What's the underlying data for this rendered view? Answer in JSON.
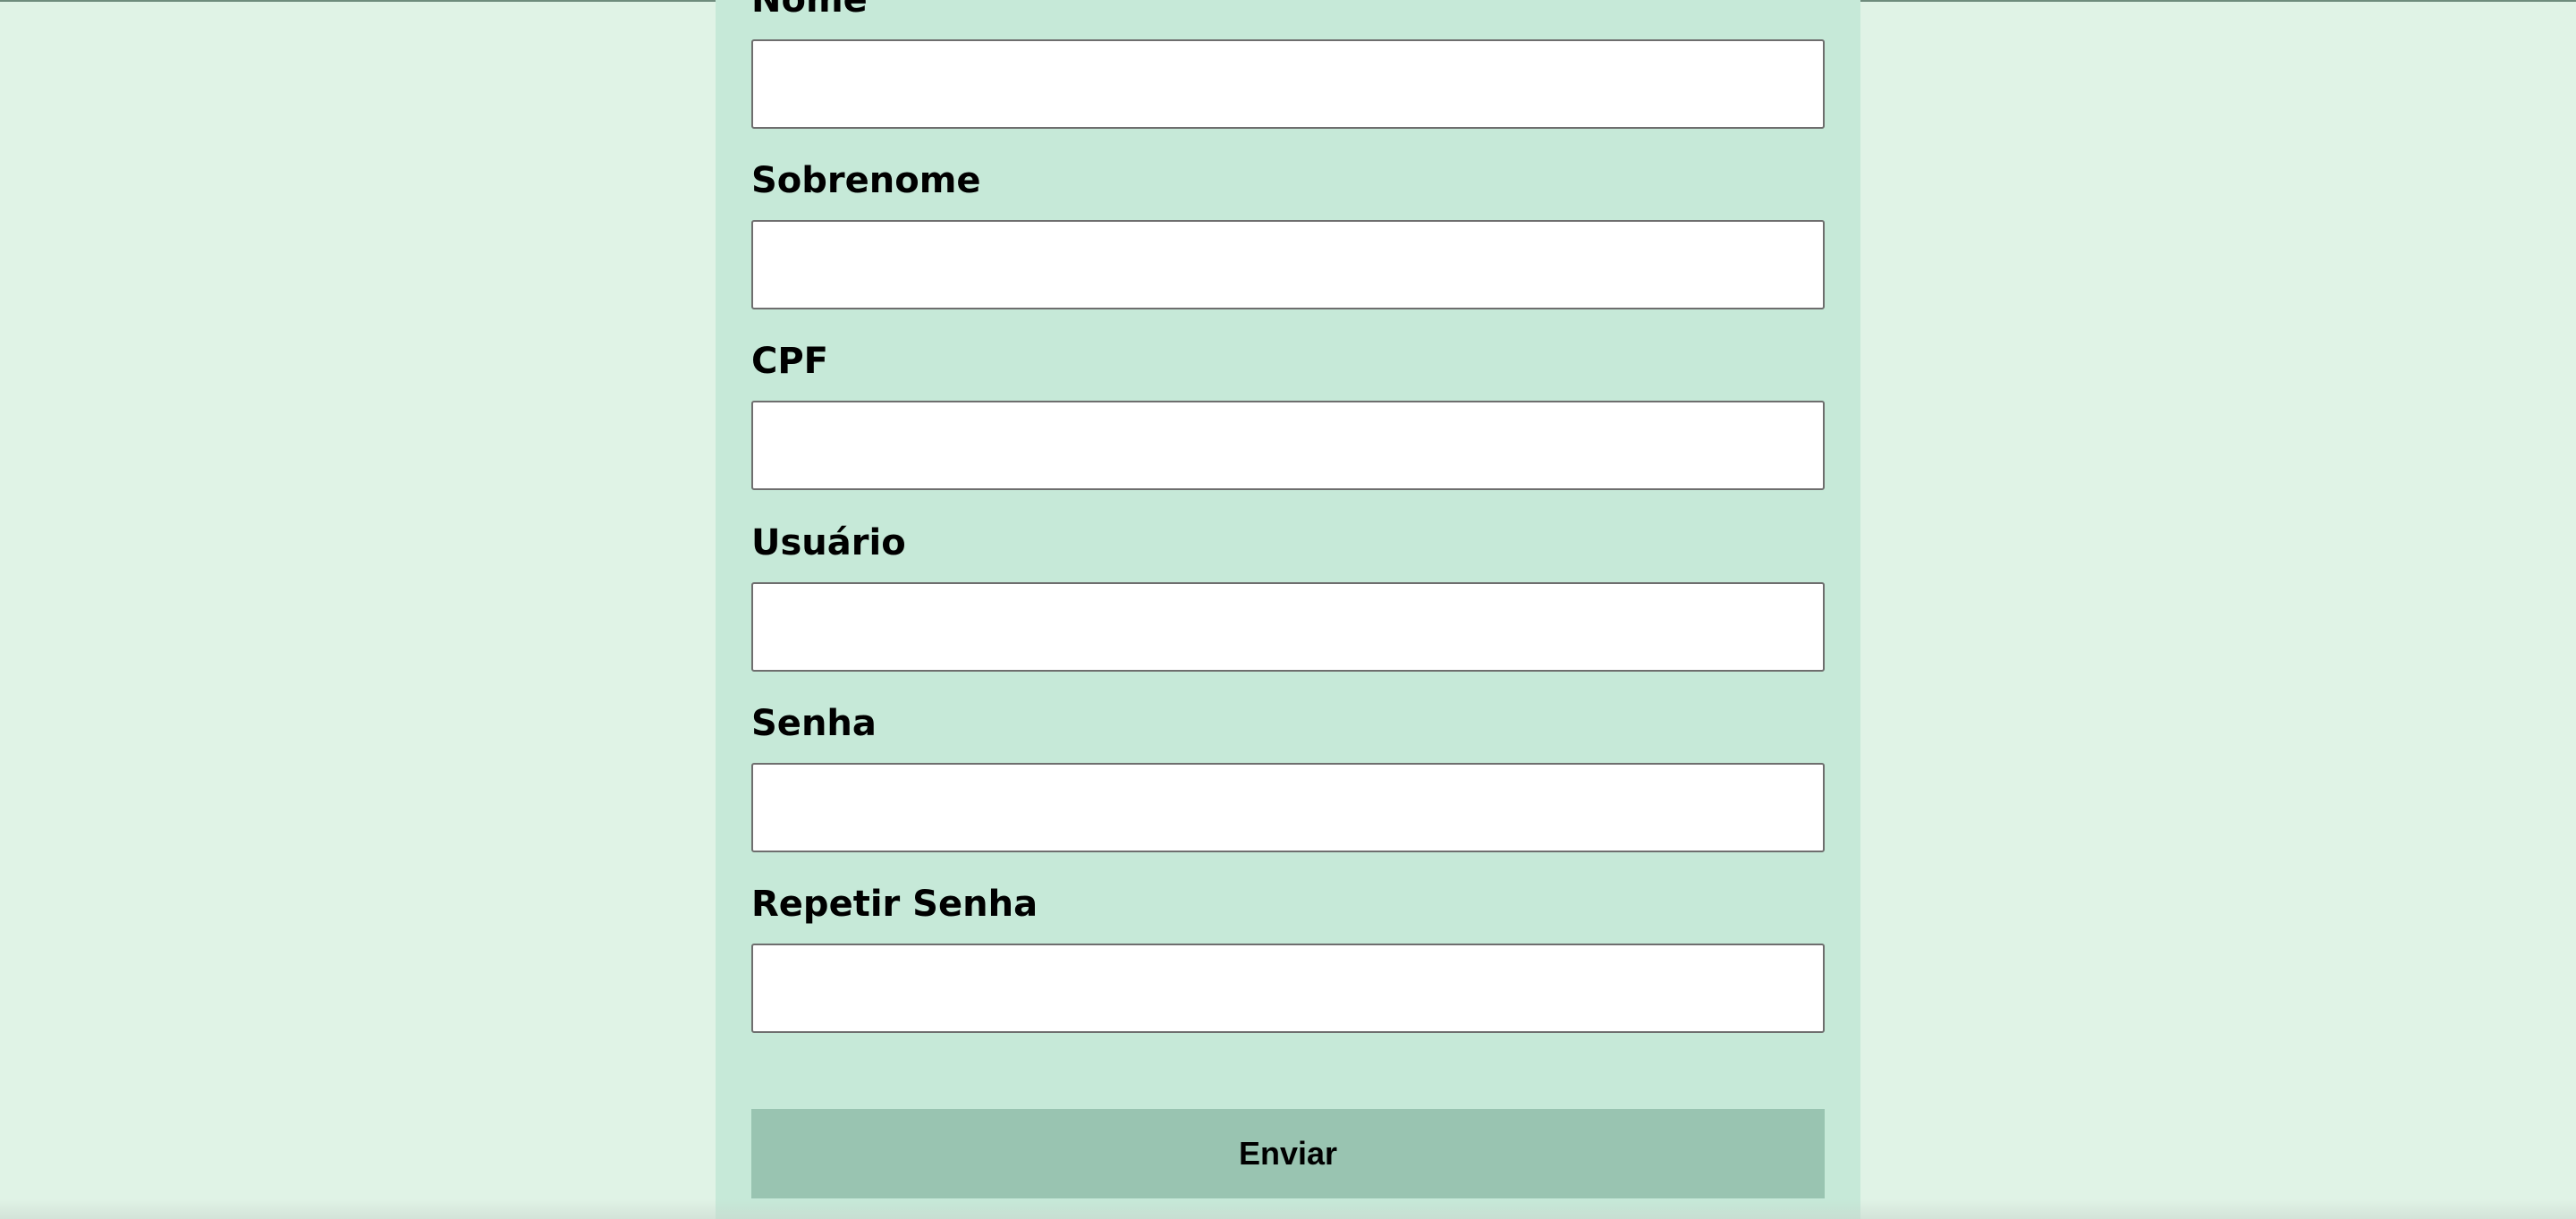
{
  "colors": {
    "page_background": "#e0f3e6",
    "panel_background": "#c6e9d8",
    "input_background": "#ffffff",
    "input_border": "#6e6e6e",
    "button_background": "#99c4b1",
    "text": "#000000"
  },
  "form": {
    "fields": [
      {
        "label": "Nome",
        "value": "",
        "placeholder": ""
      },
      {
        "label": "Sobrenome",
        "value": "",
        "placeholder": ""
      },
      {
        "label": "CPF",
        "value": "",
        "placeholder": ""
      },
      {
        "label": "Usuário",
        "value": "",
        "placeholder": ""
      },
      {
        "label": "Senha",
        "value": "",
        "placeholder": ""
      },
      {
        "label": "Repetir Senha",
        "value": "",
        "placeholder": ""
      }
    ],
    "submit_label": "Enviar"
  }
}
